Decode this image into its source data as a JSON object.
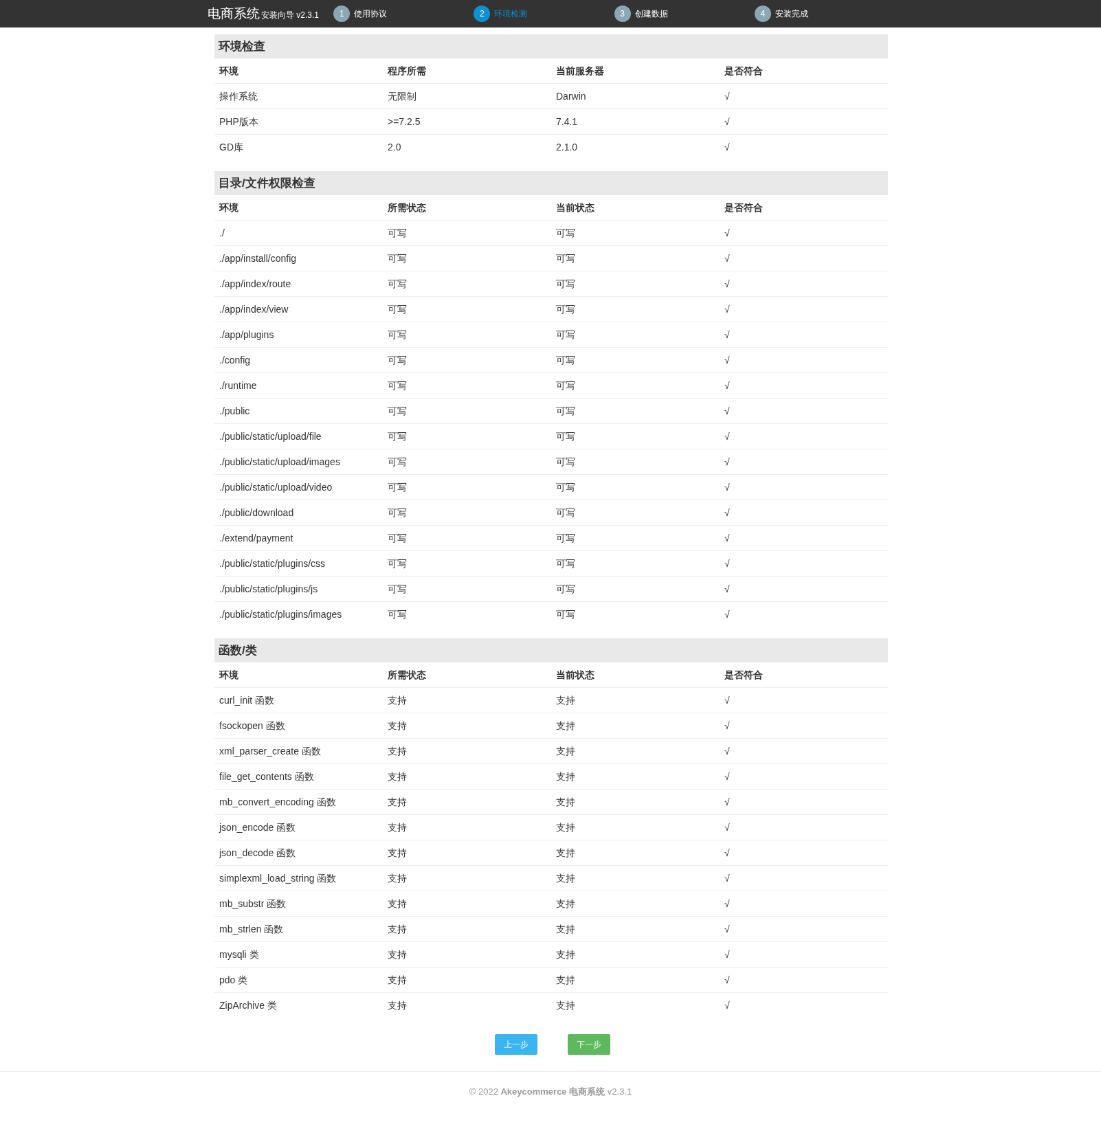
{
  "header": {
    "brand": "电商系统",
    "subtitle": "安装向导 v2.3.1",
    "steps": [
      {
        "number": "1",
        "label": "使用协议",
        "selected": false
      },
      {
        "number": "2",
        "label": "环境检测",
        "selected": true
      },
      {
        "number": "3",
        "label": "创建数据",
        "selected": false
      },
      {
        "number": "4",
        "label": "安装完成",
        "selected": false
      }
    ]
  },
  "sections": [
    {
      "title": "环境检查",
      "columns": [
        "环境",
        "程序所需",
        "当前服务器",
        "是否符合"
      ],
      "rows": [
        [
          "操作系统",
          "无限制",
          "Darwin",
          "√"
        ],
        [
          "PHP版本",
          ">=7.2.5",
          "7.4.1",
          "√"
        ],
        [
          "GD库",
          "2.0",
          "2.1.0",
          "√"
        ]
      ]
    },
    {
      "title": "目录/文件权限检查",
      "columns": [
        "环境",
        "所需状态",
        "当前状态",
        "是否符合"
      ],
      "rows": [
        [
          "./",
          "可写",
          "可写",
          "√"
        ],
        [
          "./app/install/config",
          "可写",
          "可写",
          "√"
        ],
        [
          "./app/index/route",
          "可写",
          "可写",
          "√"
        ],
        [
          "./app/index/view",
          "可写",
          "可写",
          "√"
        ],
        [
          "./app/plugins",
          "可写",
          "可写",
          "√"
        ],
        [
          "./config",
          "可写",
          "可写",
          "√"
        ],
        [
          "./runtime",
          "可写",
          "可写",
          "√"
        ],
        [
          "./public",
          "可写",
          "可写",
          "√"
        ],
        [
          "./public/static/upload/file",
          "可写",
          "可写",
          "√"
        ],
        [
          "./public/static/upload/images",
          "可写",
          "可写",
          "√"
        ],
        [
          "./public/static/upload/video",
          "可写",
          "可写",
          "√"
        ],
        [
          "./public/download",
          "可写",
          "可写",
          "√"
        ],
        [
          "./extend/payment",
          "可写",
          "可写",
          "√"
        ],
        [
          "./public/static/plugins/css",
          "可写",
          "可写",
          "√"
        ],
        [
          "./public/static/plugins/js",
          "可写",
          "可写",
          "√"
        ],
        [
          "./public/static/plugins/images",
          "可写",
          "可写",
          "√"
        ]
      ]
    },
    {
      "title": "函数/类",
      "columns": [
        "环境",
        "所需状态",
        "当前状态",
        "是否符合"
      ],
      "rows": [
        [
          "curl_init 函数",
          "支持",
          "支持",
          "√"
        ],
        [
          "fsockopen 函数",
          "支持",
          "支持",
          "√"
        ],
        [
          "xml_parser_create 函数",
          "支持",
          "支持",
          "√"
        ],
        [
          "file_get_contents 函数",
          "支持",
          "支持",
          "√"
        ],
        [
          "mb_convert_encoding 函数",
          "支持",
          "支持",
          "√"
        ],
        [
          "json_encode 函数",
          "支持",
          "支持",
          "√"
        ],
        [
          "json_decode 函数",
          "支持",
          "支持",
          "√"
        ],
        [
          "simplexml_load_string 函数",
          "支持",
          "支持",
          "√"
        ],
        [
          "mb_substr 函数",
          "支持",
          "支持",
          "√"
        ],
        [
          "mb_strlen 函数",
          "支持",
          "支持",
          "√"
        ],
        [
          "mysqli 类",
          "支持",
          "支持",
          "√"
        ],
        [
          "pdo 类",
          "支持",
          "支持",
          "√"
        ],
        [
          "ZipArchive 类",
          "支持",
          "支持",
          "√"
        ]
      ]
    }
  ],
  "buttons": [
    {
      "label": "上一步",
      "kind": "prev"
    },
    {
      "label": "下一步",
      "kind": "next"
    }
  ],
  "footer": "© 2022 **Akeycommerce 电商系统** v2.3.1"
}
